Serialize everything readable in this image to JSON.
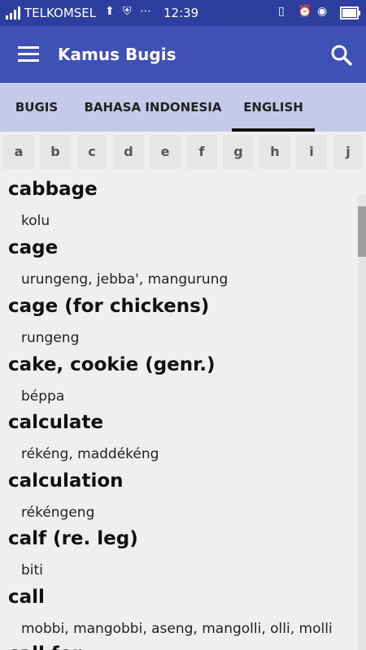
{
  "status_bar": {
    "carrier": "TELKOMSEL",
    "time": "12:39",
    "icons": [
      "signal-icon",
      "upload-icon",
      "shield-icon",
      "more-icon",
      "sim-icon",
      "alarm-icon",
      "eye-icon",
      "battery-icon"
    ]
  },
  "app_bar": {
    "title": "Kamus Bugis"
  },
  "tabs": [
    {
      "label": "BUGIS",
      "active": false
    },
    {
      "label": "BAHASA INDONESIA",
      "active": false
    },
    {
      "label": "ENGLISH",
      "active": true
    }
  ],
  "alphabet": [
    "a",
    "b",
    "c",
    "d",
    "e",
    "f",
    "g",
    "h",
    "i",
    "j"
  ],
  "entries": [
    {
      "word": "cabbage",
      "translation": "kolu"
    },
    {
      "word": "cage",
      "translation": "urungeng, jebba', mangurung"
    },
    {
      "word": "cage (for chickens)",
      "translation": "rungeng"
    },
    {
      "word": "cake, cookie (genr.)",
      "translation": "béppa"
    },
    {
      "word": "calculate",
      "translation": "rékéng, maddékéng"
    },
    {
      "word": "calculation",
      "translation": "rékéngeng"
    },
    {
      "word": "calf (re. leg)",
      "translation": "biti"
    },
    {
      "word": "call",
      "translation": "mobbi, mangobbi, aseng, mangolli, olli, molli"
    },
    {
      "word": "call for",
      "translation": ""
    }
  ],
  "colors": {
    "status_bar": "#2d3e9e",
    "app_bar": "#3f51b5",
    "tab_bar": "#c5cae9"
  }
}
